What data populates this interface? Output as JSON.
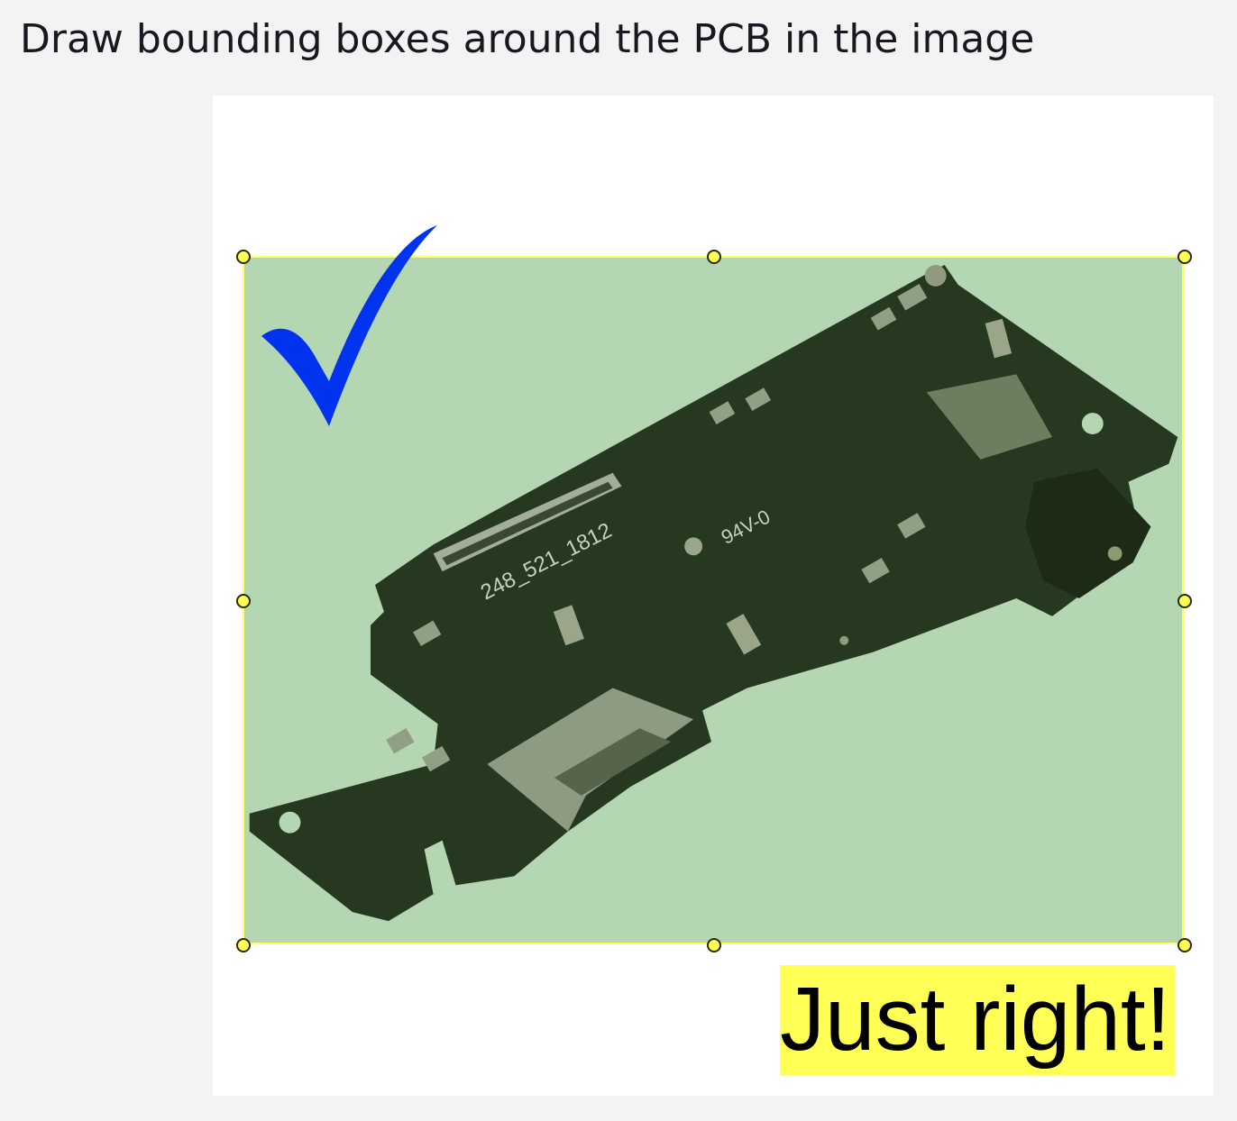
{
  "instruction": "Draw bounding boxes around the PCB in the image",
  "annotation": {
    "object_label": "PCB",
    "verdict_text": "Just right!",
    "check_icon": "checkmark-icon"
  },
  "pcb_silkscreen": {
    "part_number": "248_521_1812",
    "rating": "94V-0"
  },
  "colors": {
    "page_background": "#f2f3f3",
    "bbox_fill": "#b4d6b2",
    "bbox_stroke": "#ffff55",
    "checkmark": "#0033ee",
    "verdict_highlight": "#ffff55"
  }
}
